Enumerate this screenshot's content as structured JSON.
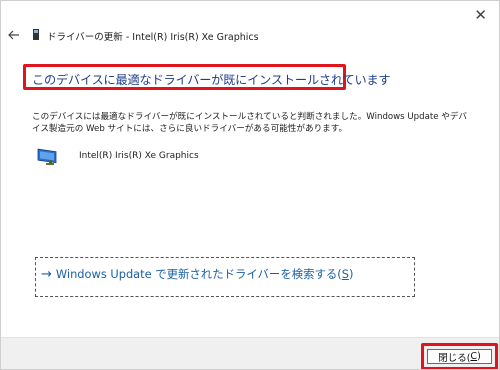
{
  "window": {
    "close_glyph": "✕",
    "title": "ドライバーの更新 - Intel(R) Iris(R) Xe Graphics"
  },
  "headline": "このデバイスに最適なドライバーが既にインストールされています",
  "description": {
    "line1": "このデバイスには最適なドライバーが既にインストールされていると判断されました。Windows Update やデバ",
    "line2": "イス製造元の Web サイトには、さらに良いドライバーがある可能性があります。"
  },
  "device": {
    "name": "Intel(R) Iris(R) Xe Graphics",
    "icon": "display-adapter-icon"
  },
  "search_link": {
    "arrow": "→",
    "text": "Windows Update で更新されたドライバーを検索する(",
    "accel": "S",
    "suffix": ")"
  },
  "footer": {
    "close_label": "閉じる(",
    "close_accel": "C",
    "close_suffix": ")"
  },
  "colors": {
    "accent": "#1f3f8c",
    "link": "#1a5fa8",
    "highlight": "#e0141c"
  }
}
